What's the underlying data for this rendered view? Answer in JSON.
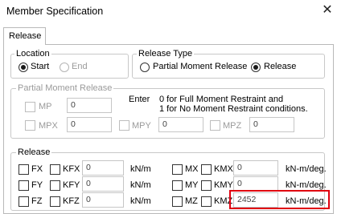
{
  "window": {
    "title": "Member Specification",
    "close_glyph": "✕"
  },
  "tabs": [
    {
      "label": "Release",
      "active": true
    }
  ],
  "location": {
    "label": "Location",
    "options": [
      {
        "label": "Start",
        "selected": true,
        "enabled": true
      },
      {
        "label": "End",
        "selected": false,
        "enabled": false
      }
    ]
  },
  "release_type": {
    "label": "Release Type",
    "options": [
      {
        "label": "Partial Moment Release",
        "selected": false
      },
      {
        "label": "Release",
        "selected": true
      }
    ]
  },
  "partial": {
    "label": "Partial Moment Release",
    "enter_label": "Enter",
    "hint_line1": "0 for Full Moment Restraint and",
    "hint_line2": "1 for No Moment Restraint conditions.",
    "mp": {
      "label": "MP",
      "value": "0"
    },
    "mpx": {
      "label": "MPX",
      "value": "0"
    },
    "mpy": {
      "label": "MPY",
      "value": "0"
    },
    "mpz": {
      "label": "MPZ",
      "value": "0"
    }
  },
  "release": {
    "label": "Release",
    "rows": [
      {
        "f": "FX",
        "k": "KFX",
        "kval": "0",
        "kunit": "kN/m",
        "m": "MX",
        "km": "KMX",
        "kmval": "0",
        "kmunit": "kN-m/deg."
      },
      {
        "f": "FY",
        "k": "KFY",
        "kval": "0",
        "kunit": "kN/m",
        "m": "MY",
        "km": "KMY",
        "kmval": "0",
        "kmunit": "kN-m/deg."
      },
      {
        "f": "FZ",
        "k": "KFZ",
        "kval": "0",
        "kunit": "kN/m",
        "m": "MZ",
        "km": "KMZ",
        "kmval": "2452",
        "kmunit": "kN-m/deg."
      }
    ]
  },
  "colors": {
    "highlight": "#e0000f",
    "border": "#b9b9b9",
    "disabled_text": "#9a9a9a"
  }
}
